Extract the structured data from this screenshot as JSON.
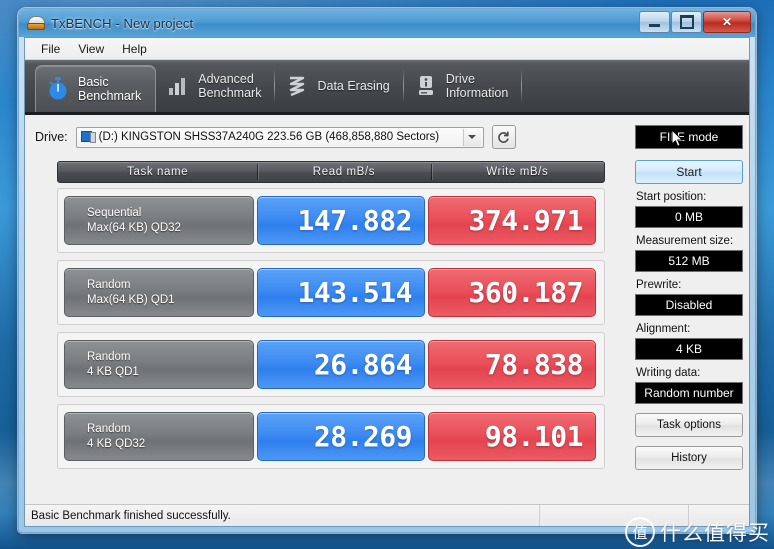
{
  "window": {
    "title": "TxBENCH - New project",
    "icon": "disk-icon",
    "buttons": {
      "minimize": "minimize-button",
      "maximize": "maximize-button",
      "close": "✕"
    }
  },
  "menu": {
    "items": [
      {
        "label": "File"
      },
      {
        "label": "View"
      },
      {
        "label": "Help"
      }
    ]
  },
  "tabs": [
    {
      "label": "Basic\nBenchmark",
      "icon": "stopwatch-icon",
      "active": true
    },
    {
      "label": "Advanced\nBenchmark",
      "icon": "bar-chart-icon",
      "active": false
    },
    {
      "label": "Data Erasing",
      "icon": "shredder-icon",
      "active": false
    },
    {
      "label": "Drive\nInformation",
      "icon": "drive-info-icon",
      "active": false
    }
  ],
  "drive": {
    "label": "Drive:",
    "selected": "(D:) KINGSTON SHSS37A240G  223.56 GB (468,858,880 Sectors)",
    "refresh_icon": "refresh-icon",
    "dropdown_icon": "chevron-down-icon"
  },
  "table": {
    "headers": {
      "task": "Task name",
      "read": "Read mB/s",
      "write": "Write mB/s"
    },
    "rows": [
      {
        "task_line1": "Sequential",
        "task_line2": "Max(64 KB) QD32",
        "read": "147.882",
        "write": "374.971"
      },
      {
        "task_line1": "Random",
        "task_line2": "Max(64 KB) QD1",
        "read": "143.514",
        "write": "360.187"
      },
      {
        "task_line1": "Random",
        "task_line2": "4 KB QD1",
        "read": "26.864",
        "write": "78.838"
      },
      {
        "task_line1": "Random",
        "task_line2": "4 KB QD32",
        "read": "28.269",
        "write": "98.101"
      }
    ]
  },
  "sidebar": {
    "file_mode": "FILE mode",
    "start_button": "Start",
    "start_position_label": "Start position:",
    "start_position_value": "0 MB",
    "measurement_size_label": "Measurement size:",
    "measurement_size_value": "512 MB",
    "prewrite_label": "Prewrite:",
    "prewrite_value": "Disabled",
    "alignment_label": "Alignment:",
    "alignment_value": "4 KB",
    "writing_data_label": "Writing data:",
    "writing_data_value": "Random number",
    "task_options_button": "Task options",
    "history_button": "History"
  },
  "statusbar": {
    "message": "Basic Benchmark finished successfully."
  },
  "watermark": {
    "logo_char": "值",
    "text": "什么值得买"
  },
  "colors": {
    "read_blue": "#3d8bf2",
    "write_red": "#e9505a",
    "tab_dark": "#44484c",
    "value_black": "#000000",
    "title_blue": "#4e9cd4"
  }
}
